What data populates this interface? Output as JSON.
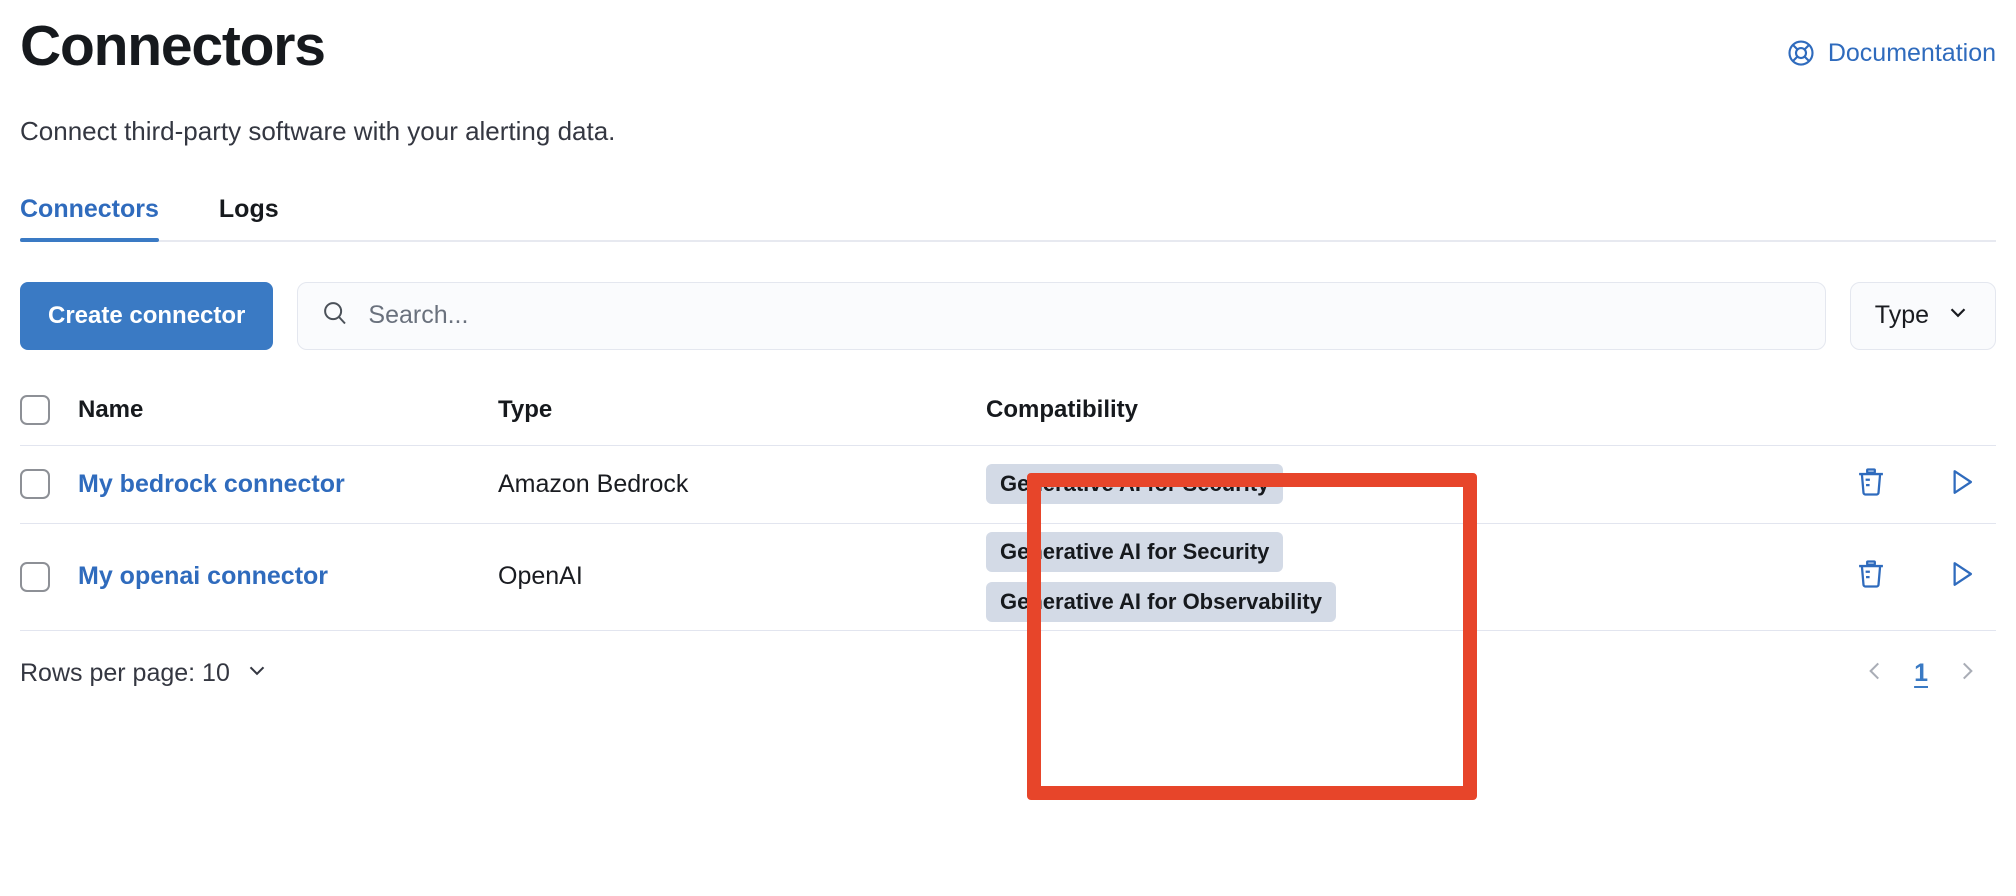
{
  "header": {
    "title": "Connectors",
    "subtitle": "Connect third-party software with your alerting data.",
    "documentation_label": "Documentation",
    "documentation_icon": "lifebuoy-icon",
    "documentation_color": "#2f6bbd"
  },
  "tabs": [
    {
      "label": "Connectors",
      "active": true
    },
    {
      "label": "Logs",
      "active": false
    }
  ],
  "toolbar": {
    "create_label": "Create connector",
    "create_color": "#3a7ac4",
    "search_placeholder": "Search...",
    "search_value": "",
    "search_icon": "search-icon",
    "type_filter_label": "Type",
    "type_filter_icon": "chevron-down-icon"
  },
  "table": {
    "columns": [
      "Name",
      "Type",
      "Compatibility"
    ],
    "rows": [
      {
        "name": "My bedrock connector",
        "type": "Amazon Bedrock",
        "compatibility": [
          "Generative AI for Security"
        ],
        "selected": false,
        "actions": [
          "trash-icon",
          "play-icon"
        ]
      },
      {
        "name": "My openai connector",
        "type": "OpenAI",
        "compatibility": [
          "Generative AI for Security",
          "Generative AI for Observability"
        ],
        "selected": false,
        "actions": [
          "trash-icon",
          "play-icon"
        ]
      }
    ],
    "badge_bg": "#d3dae6"
  },
  "footer": {
    "rows_per_page_label": "Rows per page: 10",
    "rows_per_page_icon": "chevron-down-icon",
    "prev_icon": "chevron-left-icon",
    "next_icon": "chevron-right-icon",
    "current_page": "1"
  },
  "annotation": {
    "color": "#e7452a",
    "target": "compatibility-column"
  }
}
